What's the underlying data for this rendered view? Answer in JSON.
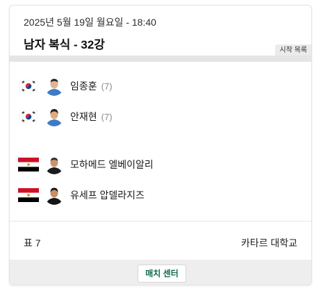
{
  "match": {
    "date": "2025년 5월 19일 월요일 - 18:40",
    "title": "남자 복식 - 32강",
    "tag": "시작 목록"
  },
  "teams": [
    {
      "flag": "korea",
      "players": [
        {
          "name": "임종훈",
          "seed": "(7)"
        },
        {
          "name": "안재현",
          "seed": "(7)"
        }
      ]
    },
    {
      "flag": "egypt",
      "players": [
        {
          "name": "모하메드 엘베이알리",
          "seed": ""
        },
        {
          "name": "유세프 압델라지즈",
          "seed": ""
        }
      ]
    }
  ],
  "footer": {
    "table": "표 7",
    "venue": "카타르 대학교",
    "button": "매치 센터"
  },
  "colors": {
    "accent": "#0f6b4f",
    "korea_red": "#cd2e3a",
    "korea_blue": "#0047a0",
    "egypt_red": "#ce1126",
    "egypt_gold": "#c09300"
  }
}
